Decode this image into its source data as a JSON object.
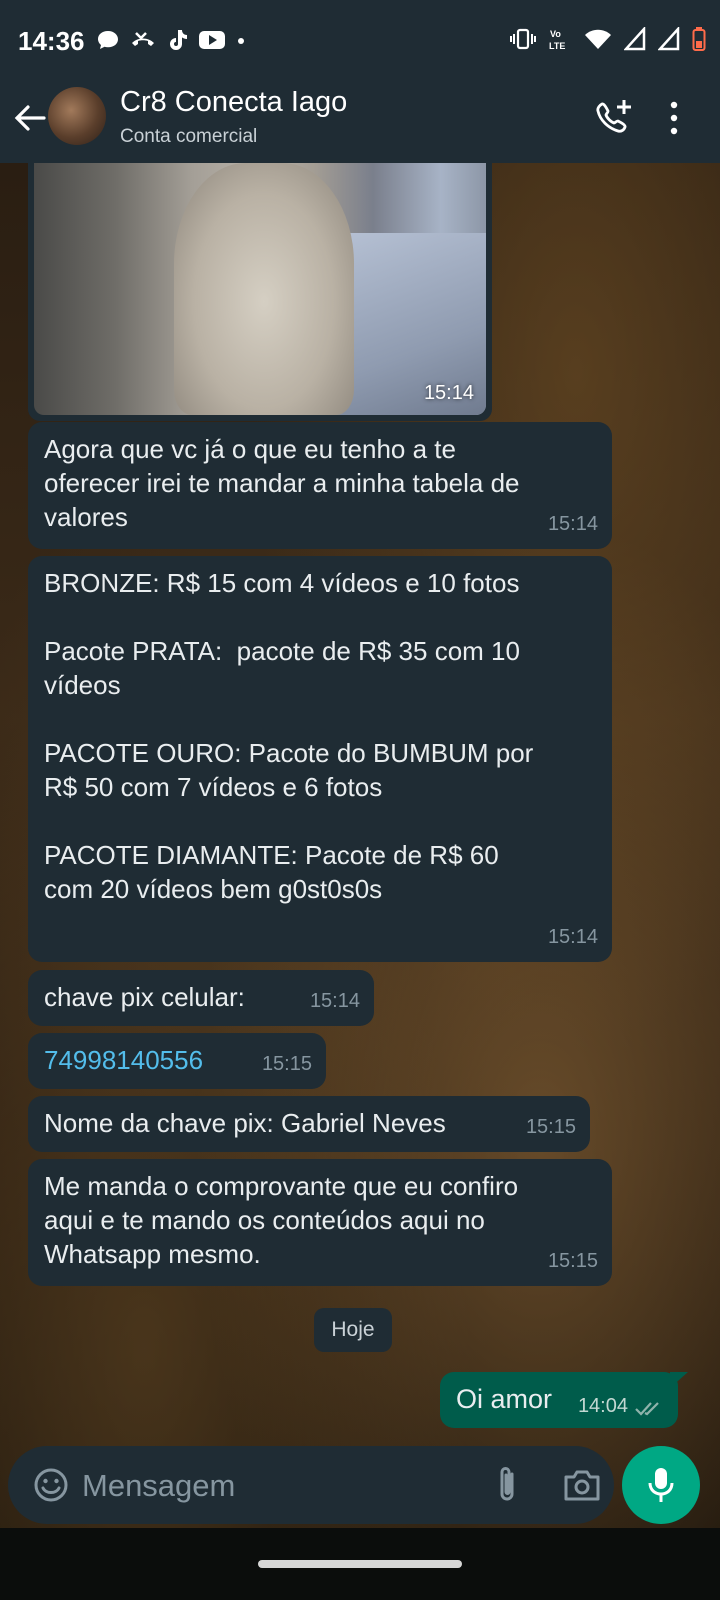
{
  "status_bar": {
    "time": "14:36",
    "icons": [
      "chat-bubble-icon",
      "missed-call-icon",
      "tiktok-icon",
      "youtube-icon",
      "dot-icon",
      "vibrate-icon",
      "volte-icon",
      "wifi-icon",
      "signal-icon",
      "signal-icon",
      "battery-low-icon"
    ]
  },
  "header": {
    "title": "Cr8 Conecta Iago",
    "subtitle": "Conta comercial"
  },
  "messages": [
    {
      "type": "image",
      "time": "15:14"
    },
    {
      "type": "text",
      "text": "Agora que vc já o que eu tenho a te\noferecer irei te mandar a minha tabela de\nvalores",
      "time": "15:14"
    },
    {
      "type": "text",
      "text": "BRONZE: R$ 15 com 4 vídeos e 10 fotos\n\nPacote PRATA:  pacote de R$ 35 com 10\nvídeos\n\nPACOTE OURO: Pacote do BUMBUM por\nR$ 50 com 7 vídeos e 6 fotos\n\nPACOTE DIAMANTE: Pacote de R$ 60\ncom 20 vídeos bem g0st0s0s",
      "time": "15:14"
    },
    {
      "type": "text",
      "text": "chave pix celular:",
      "time": "15:14"
    },
    {
      "type": "link",
      "text": "74998140556",
      "time": "15:15"
    },
    {
      "type": "text",
      "text": "Nome da chave pix: Gabriel Neves",
      "time": "15:15"
    },
    {
      "type": "text",
      "text": "Me manda o comprovante que eu confiro\naqui e te mando os conteúdos aqui no\nWhatsapp mesmo.",
      "time": "15:15"
    }
  ],
  "day_separator": "Hoje",
  "outgoing": {
    "text": "Oi amor",
    "time": "14:04",
    "status": "read"
  },
  "composer": {
    "placeholder": "Mensagem",
    "value": ""
  },
  "colors": {
    "header_bg": "#1f2c34",
    "incoming_bubble": "#1f2c34",
    "outgoing_bubble": "#005c4b",
    "accent": "#00a884",
    "link": "#53bdeb"
  }
}
